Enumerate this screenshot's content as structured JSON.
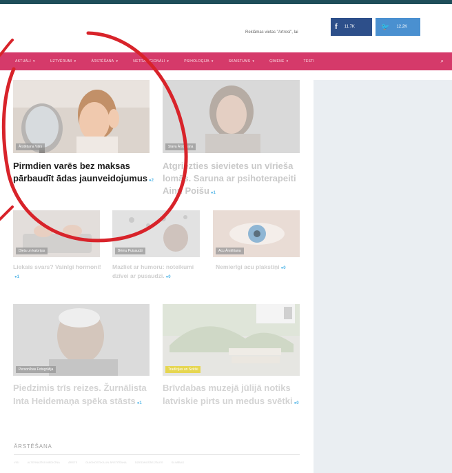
{
  "header": {
    "note": "Reklāmas vietas \"Artrosi\", lai",
    "facebook_count": "11.7K",
    "twitter_count": "12.2K"
  },
  "nav": {
    "items": [
      "Aktuāli",
      "Uztvērumi",
      "Ārstēšana",
      "Netradicionāli",
      "Psiholoģija",
      "Skaistums",
      "Ģimene",
      "Testi"
    ]
  },
  "articles": {
    "featured": [
      {
        "tag": "Ārstēšana Vārs",
        "title": "Pirmdien varēs bez maksas pārbaudīt ādas jaunveidojumus",
        "comments": "2"
      },
      {
        "tag": "Slava Ārstēšana",
        "title": "Atgriezties sievietes un vīrieša lomās. Saruna ar psihoterapeiti Ainu Poišu",
        "comments": "1"
      }
    ],
    "small": [
      {
        "tag": "Dieta un kalorijas",
        "title": "Liekais svars? Vainīgi hormoni!",
        "comments": "1"
      },
      {
        "tag": "Bērnu Puisaudzi",
        "title": "Mazliet ar humoru: noteikumi dzīvei ar pusaudzi.",
        "comments": "0"
      },
      {
        "tag": "Acu Ārstēšana",
        "title": "Nemierīgi acu plakstiņi",
        "comments": "0"
      }
    ],
    "bottom": [
      {
        "tag": "Personības Fotogrāfija",
        "title": "Piedzimis trīs reizes. Žurnālista Inta Heidemaņa spēka stāsts",
        "comments": "1"
      },
      {
        "tag": "Tradīcijas un Svētki",
        "title": "Brīvdabas muzejā jūlijā notiks latviskie pirts un medus svētki",
        "comments": "0"
      }
    ]
  },
  "section": {
    "title": "ĀRSTĒŠANA",
    "links": [
      "Visi",
      "Alternatīvā medicīna",
      "Ārsts",
      "Diagnostika un ārstēšana",
      "Dziedinošās zāles",
      "Slimības"
    ]
  },
  "colors": {
    "nav_bg": "#d53a6a",
    "topbar": "#1e4e5a",
    "annotation": "#d8232a",
    "comment_icon": "#58b8e8"
  }
}
